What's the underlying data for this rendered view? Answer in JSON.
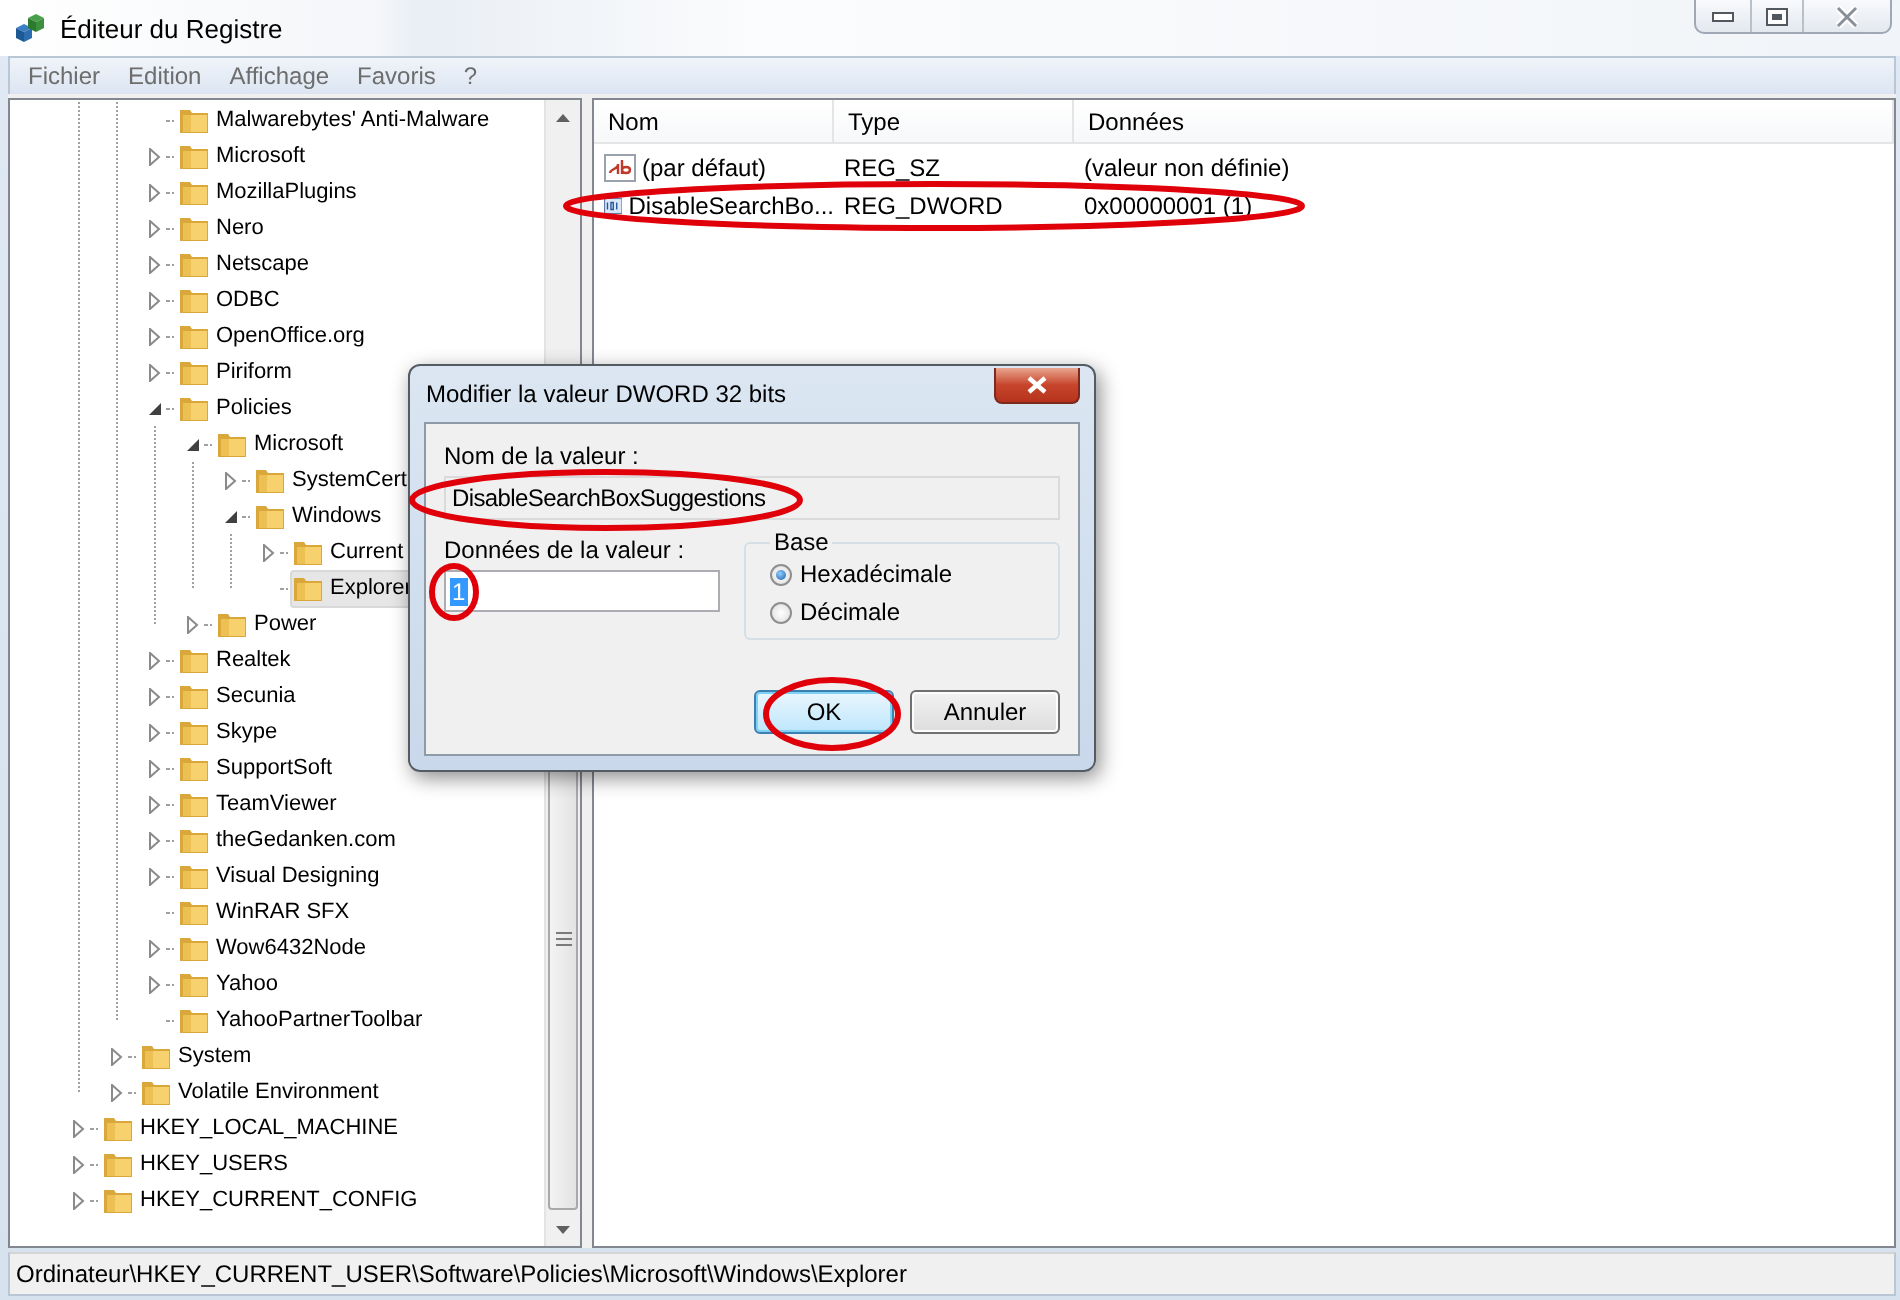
{
  "window": {
    "title": "Éditeur du Registre"
  },
  "menu": [
    {
      "label": "Fichier"
    },
    {
      "label": "Edition"
    },
    {
      "label": "Affichage"
    },
    {
      "label": "Favoris"
    },
    {
      "label": "?"
    }
  ],
  "tree": {
    "items": [
      {
        "children": [
          {
            "children": [
              {
                "label": "Malwarebytes' Anti-Malware",
                "selected": false
              },
              {
                "label": "Microsoft",
                "expanded": false,
                "selected": false
              },
              {
                "label": "MozillaPlugins",
                "expanded": false,
                "selected": false
              },
              {
                "label": "Nero",
                "expanded": false,
                "selected": false
              },
              {
                "label": "Netscape",
                "expanded": false,
                "selected": false
              },
              {
                "label": "ODBC",
                "expanded": false,
                "selected": false
              },
              {
                "label": "OpenOffice.org",
                "expanded": false,
                "selected": false
              },
              {
                "label": "Piriform",
                "expanded": false,
                "selected": false
              },
              {
                "label": "Policies",
                "expanded": true,
                "selected": false,
                "children": [
                  {
                    "label": "Microsoft",
                    "expanded": true,
                    "selected": false,
                    "children": [
                      {
                        "label": "SystemCert",
                        "expanded": false,
                        "selected": false
                      },
                      {
                        "label": "Windows",
                        "expanded": true,
                        "selected": false,
                        "children": [
                          {
                            "label": "Current",
                            "expanded": false,
                            "selected": false
                          },
                          {
                            "label": "Explorer",
                            "selected": true
                          }
                        ]
                      }
                    ]
                  },
                  {
                    "label": "Power",
                    "expanded": false,
                    "selected": false
                  }
                ]
              },
              {
                "label": "Realtek",
                "expanded": false,
                "selected": false
              },
              {
                "label": "Secunia",
                "expanded": false,
                "selected": false
              },
              {
                "label": "Skype",
                "expanded": false,
                "selected": false
              },
              {
                "label": "SupportSoft",
                "expanded": false,
                "selected": false
              },
              {
                "label": "TeamViewer",
                "expanded": false,
                "selected": false
              },
              {
                "label": "theGedanken.com",
                "expanded": false,
                "selected": false
              },
              {
                "label": "Visual Designing",
                "expanded": false,
                "selected": false
              },
              {
                "label": "WinRAR SFX",
                "selected": false
              },
              {
                "label": "Wow6432Node",
                "expanded": false,
                "selected": false
              },
              {
                "label": "Yahoo",
                "expanded": false,
                "selected": false
              },
              {
                "label": "YahooPartnerToolbar",
                "selected": false
              }
            ]
          },
          {
            "label": "System",
            "expanded": false,
            "selected": false
          },
          {
            "label": "Volatile Environment",
            "expanded": false,
            "selected": false
          }
        ]
      },
      {
        "label": "HKEY_LOCAL_MACHINE",
        "expanded": false,
        "selected": false
      },
      {
        "label": "HKEY_USERS",
        "expanded": false,
        "selected": false
      },
      {
        "label": "HKEY_CURRENT_CONFIG",
        "expanded": false,
        "selected": false
      }
    ]
  },
  "values": {
    "columns": [
      "Nom",
      "Type",
      "Données"
    ],
    "rows": [
      {
        "kind": "string",
        "name": "(par défaut)",
        "type": "REG_SZ",
        "data": "(valeur non définie)",
        "selected": false
      },
      {
        "kind": "dword",
        "name": "DisableSearchBo...",
        "type": "REG_DWORD",
        "data": "0x00000001 (1)",
        "selected": false
      }
    ]
  },
  "status_bar": "Ordinateur\\HKEY_CURRENT_USER\\Software\\Policies\\Microsoft\\Windows\\Explorer",
  "dialog": {
    "title": "Modifier la valeur DWORD 32 bits",
    "name_label": "Nom de la valeur :",
    "name_value": "DisableSearchBoxSuggestions",
    "data_label": "Données de la valeur :",
    "data_value": "1",
    "data_value_selected": true,
    "base": {
      "title": "Base",
      "options": [
        {
          "label": "Hexadécimale",
          "selected": true
        },
        {
          "label": "Décimale",
          "selected": false
        }
      ]
    },
    "buttons": [
      {
        "label": "OK",
        "default": true
      },
      {
        "label": "Annuler",
        "default": false
      }
    ]
  }
}
